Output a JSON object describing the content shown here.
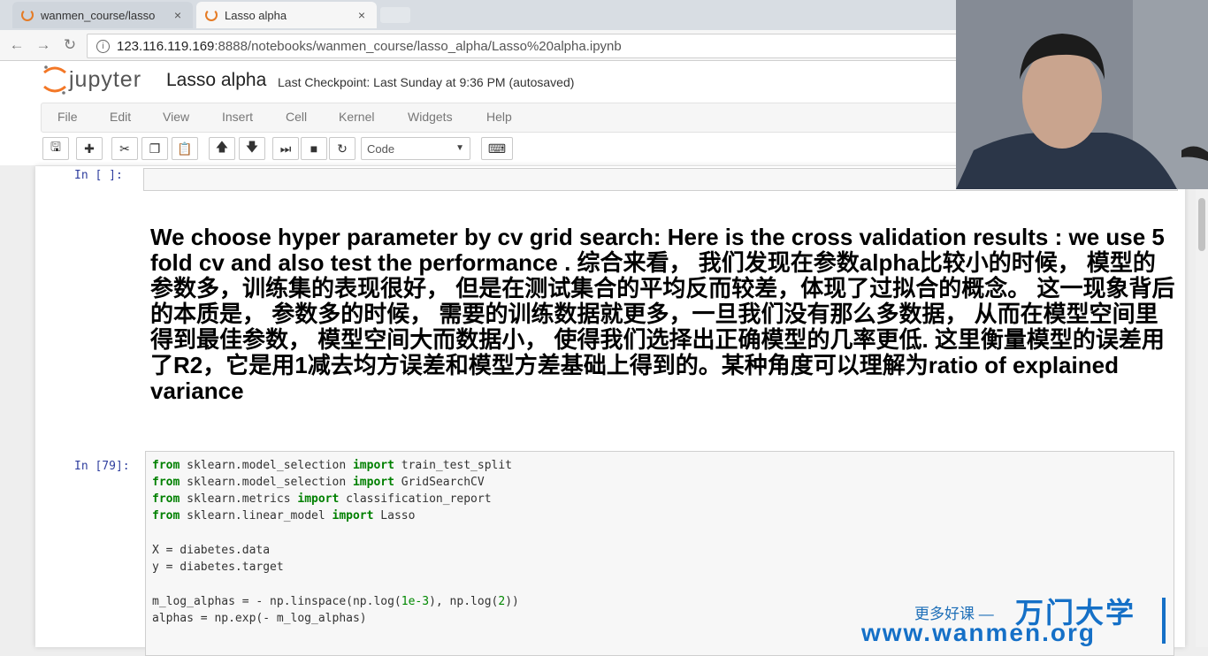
{
  "browser": {
    "tabs": [
      {
        "label": "wanmen_course/lasso",
        "close": "×"
      },
      {
        "label": "Lasso alpha",
        "close": "×"
      }
    ],
    "url_host": "123.116.119.169",
    "url_path": ":8888/notebooks/wanmen_course/lasso_alpha/Lasso%20alpha.ipynb"
  },
  "jupyter": {
    "logo_text": "jupyter",
    "notebook_title": "Lasso alpha",
    "checkpoint": "Last Checkpoint: Last Sunday at 9:36 PM (autosaved)",
    "menu": [
      "File",
      "Edit",
      "View",
      "Insert",
      "Cell",
      "Kernel",
      "Widgets",
      "Help"
    ],
    "cell_type": "Code"
  },
  "cells": {
    "empty_prompt": "In [ ]:",
    "markdown_text": "We choose hyper parameter by cv grid search: Here is the cross validation results : we use 5 fold cv and also test the performance . 综合来看， 我们发现在参数alpha比较小的时候， 模型的参数多，训练集的表现很好， 但是在测试集合的平均反而较差，体现了过拟合的概念。 这一现象背后的本质是， 参数多的时候， 需要的训练数据就更多，一旦我们没有那么多数据， 从而在模型空间里得到最佳参数， 模型空间大而数据小， 使得我们选择出正确模型的几率更低. 这里衡量模型的误差用了R2，它是用1减去均方误差和模型方差基础上得到的。某种角度可以理解为ratio of explained variance",
    "code_prompt": "In [79]:",
    "code": {
      "l1_from": "from",
      "l1_mod": " sklearn.model_selection ",
      "l1_import": "import",
      "l1_name": " train_test_split",
      "l2_from": "from",
      "l2_mod": " sklearn.model_selection ",
      "l2_import": "import",
      "l2_name": " GridSearchCV",
      "l3_from": "from",
      "l3_mod": " sklearn.metrics ",
      "l3_import": "import",
      "l3_name": " classification_report",
      "l4_from": "from",
      "l4_mod": " sklearn.linear_model ",
      "l4_import": "import",
      "l4_name": " Lasso",
      "l5": "X = diabetes.data",
      "l6": "y = diabetes.target",
      "l7a": "m_log_alphas = - np.linspace(np.log(",
      "l7b": "1e-3",
      "l7c": "), np.log(",
      "l7d": "2",
      "l7e": "))",
      "l8": "alphas = np.exp(- m_log_alphas)"
    }
  },
  "watermark": {
    "slogan": "更多好课 —",
    "brand": "万门大学",
    "url": "www.wanmen.org"
  }
}
